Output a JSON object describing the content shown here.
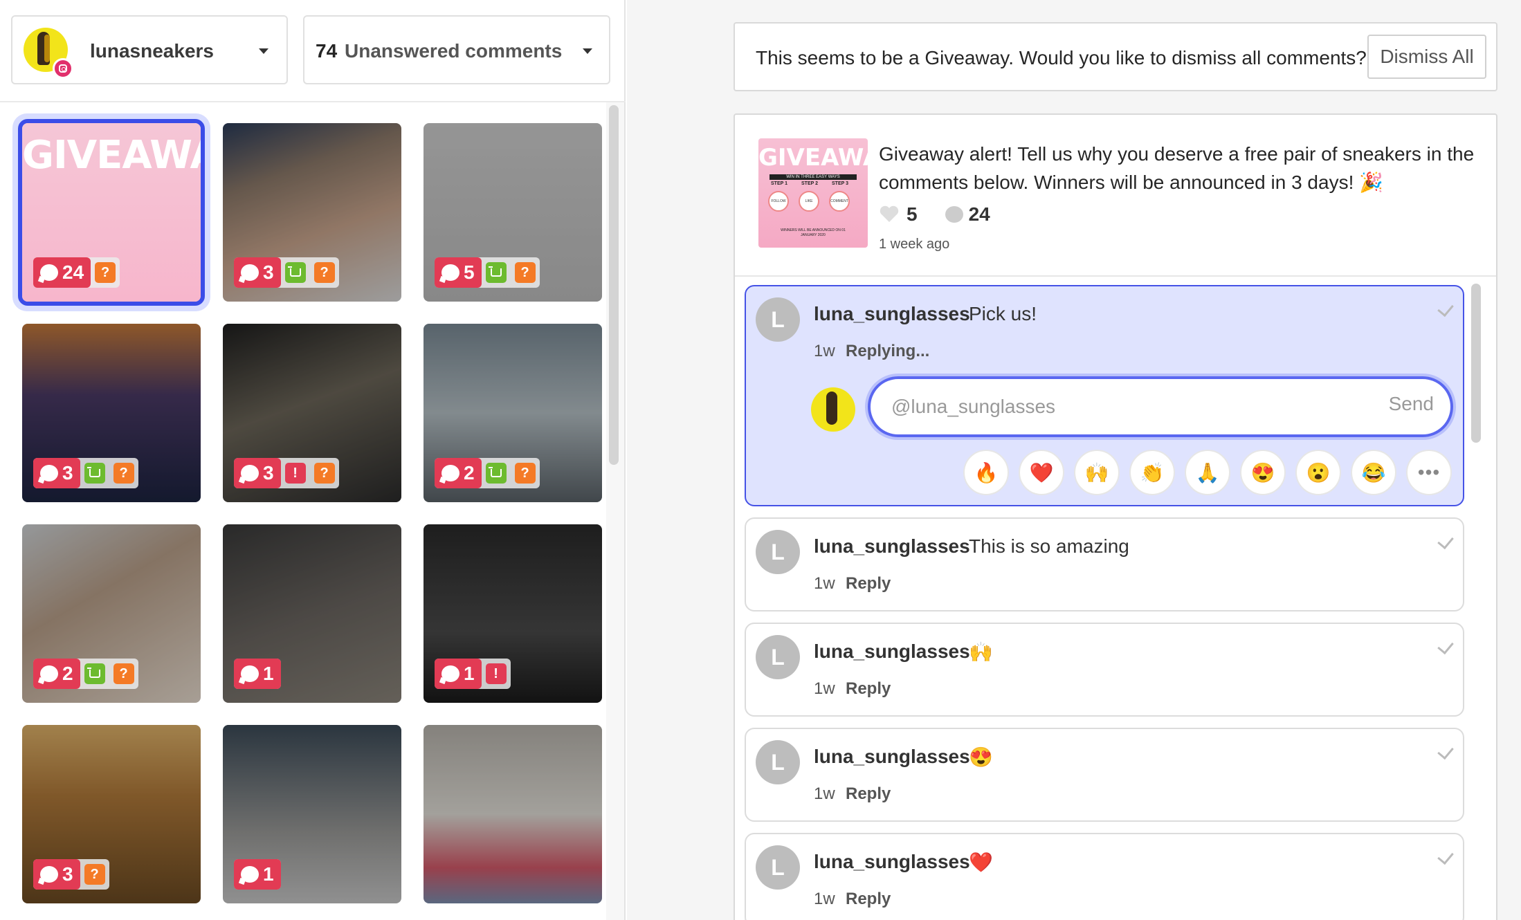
{
  "account": {
    "name": "lunasneakers"
  },
  "filter": {
    "count": "74",
    "label": "Unanswered comments"
  },
  "banner": {
    "text": "This seems to be a Giveaway. Would you like to dismiss all comments?",
    "dismiss_label": "Dismiss All"
  },
  "post": {
    "caption": "Giveaway alert! Tell us why you deserve a free pair of sneakers in the comments below. Winners will be announced in 3 days! 🎉",
    "likes": "5",
    "comments": "24",
    "time": "1 week ago",
    "thumb_title": "GIVEAWAY",
    "thumb_sub": "WIN IN THREE EASY WAYS",
    "thumb_steps": [
      "STEP 1",
      "STEP 2",
      "STEP 3"
    ],
    "thumb_actions": [
      "FOLLOW",
      "LIKE",
      "COMMENT"
    ],
    "thumb_footer": "WINNERS WILL BE ANNOUNCED ON 01 JANUARY 2020"
  },
  "grid": [
    {
      "count": "24",
      "icons": [
        "q"
      ],
      "title": "GIVEAWAY"
    },
    {
      "count": "3",
      "icons": [
        "cart",
        "q"
      ]
    },
    {
      "count": "5",
      "icons": [
        "cart",
        "q"
      ]
    },
    {
      "count": "3",
      "icons": [
        "cart",
        "q"
      ]
    },
    {
      "count": "3",
      "icons": [
        "ex",
        "q"
      ]
    },
    {
      "count": "2",
      "icons": [
        "cart",
        "q"
      ]
    },
    {
      "count": "2",
      "icons": [
        "cart",
        "q"
      ]
    },
    {
      "count": "1",
      "icons": []
    },
    {
      "count": "1",
      "icons": [
        "ex"
      ]
    },
    {
      "count": "3",
      "icons": [
        "q"
      ]
    },
    {
      "count": "1",
      "icons": []
    },
    {
      "count": "",
      "icons": []
    }
  ],
  "comments": [
    {
      "avatar": "L",
      "user": "luna_sunglasses",
      "text": "Pick us!",
      "time": "1w",
      "action": "Replying..."
    },
    {
      "avatar": "L",
      "user": "luna_sunglasses",
      "text": "This is so amazing",
      "time": "1w",
      "action": "Reply"
    },
    {
      "avatar": "L",
      "user": "luna_sunglasses",
      "text": "🙌",
      "time": "1w",
      "action": "Reply"
    },
    {
      "avatar": "L",
      "user": "luna_sunglasses",
      "text": "😍",
      "time": "1w",
      "action": "Reply"
    },
    {
      "avatar": "L",
      "user": "luna_sunglasses",
      "text": "❤️",
      "time": "1w",
      "action": "Reply"
    }
  ],
  "reply": {
    "value": "@luna_sunglasses ",
    "send_label": "Send"
  },
  "emojis": [
    "🔥",
    "❤️",
    "🙌",
    "👏",
    "🙏",
    "😍",
    "😮",
    "😂"
  ],
  "more_label": "•••",
  "colors": {
    "accent": "#4552e6",
    "count_badge": "#e23b54",
    "cart": "#6dbb2f",
    "question": "#f47a26",
    "selected_bg": "#dfe3fe"
  }
}
